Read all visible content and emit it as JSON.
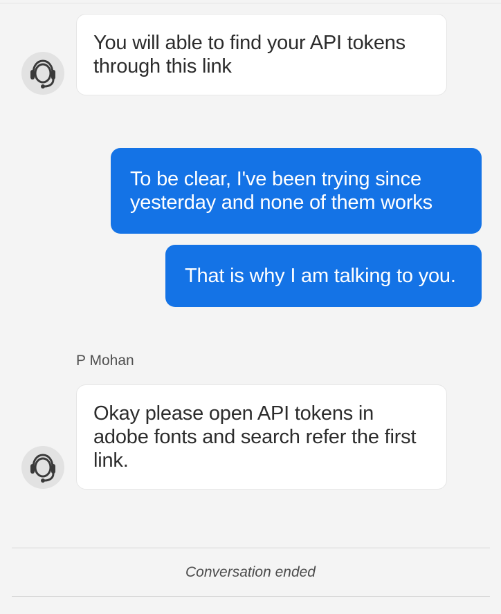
{
  "messages": [
    {
      "sender": "agent",
      "text": "You will able to find your API tokens through this link"
    },
    {
      "sender": "user",
      "text": "To be clear, I've been trying since yesterday and none of them works"
    },
    {
      "sender": "user",
      "text": "That is why I am talking to you."
    },
    {
      "sender": "agent",
      "name": "P Mohan",
      "text": "Okay please open API tokens in adobe fonts and search refer the first link."
    }
  ],
  "status": {
    "ended_label": "Conversation ended"
  },
  "colors": {
    "background": "#f4f4f4",
    "agent_bubble": "#ffffff",
    "user_bubble": "#1473e6",
    "user_text": "#ffffff",
    "agent_text": "#2c2c2c"
  },
  "icons": {
    "agent_avatar": "headset-icon"
  }
}
